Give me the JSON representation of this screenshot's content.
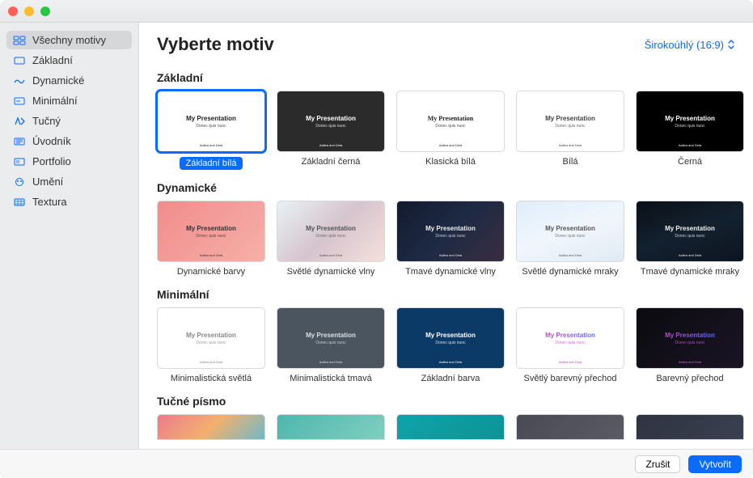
{
  "header": {
    "title": "Vyberte motiv",
    "aspect": "Širokoúhlý (16:9)"
  },
  "thumb_text": {
    "heading": "My Presentation",
    "sub": "Donec quis nunc",
    "foot": "Aaliea and Dela"
  },
  "sidebar": {
    "items": [
      {
        "label": "Všechny motivy",
        "icon": "grid-icon",
        "selected": true
      },
      {
        "label": "Základní",
        "icon": "basic-icon"
      },
      {
        "label": "Dynamické",
        "icon": "dynamic-icon"
      },
      {
        "label": "Minimální",
        "icon": "minimal-icon"
      },
      {
        "label": "Tučný",
        "icon": "bold-icon"
      },
      {
        "label": "Úvodník",
        "icon": "editorial-icon"
      },
      {
        "label": "Portfolio",
        "icon": "portfolio-icon"
      },
      {
        "label": "Umění",
        "icon": "art-icon"
      },
      {
        "label": "Textura",
        "icon": "texture-icon"
      }
    ]
  },
  "sections": [
    {
      "title": "Základní",
      "items": [
        {
          "label": "Základní bílá",
          "selected": true,
          "bg": "#ffffff",
          "fg": "#222"
        },
        {
          "label": "Základní černá",
          "bg": "#2b2b2b",
          "fg": "#fff"
        },
        {
          "label": "Klasická bílá",
          "bg": "#ffffff",
          "fg": "#222",
          "serif": true
        },
        {
          "label": "Bílá",
          "bg": "#ffffff",
          "fg": "#444"
        },
        {
          "label": "Černá",
          "bg": "#000000",
          "fg": "#fff"
        }
      ]
    },
    {
      "title": "Dynamické",
      "items": [
        {
          "label": "Dynamické barvy",
          "bg": "linear-gradient(135deg,#f08c8c,#f6b0a8)",
          "fg": "#333"
        },
        {
          "label": "Světlé dynamické vlny",
          "bg": "linear-gradient(135deg,#e8f2f4,#d6c4ce,#f4e1db)",
          "fg": "#555"
        },
        {
          "label": "Tmavé dynamické vlny",
          "bg": "linear-gradient(135deg,#121a2e,#1e2a44,#3a2d3f)",
          "fg": "#eee"
        },
        {
          "label": "Světlé dynamické mraky",
          "bg": "linear-gradient(160deg,#dfeefb,#f0f6fc,#e1eaf4)",
          "fg": "#555"
        },
        {
          "label": "Tmavé dynamické mraky",
          "bg": "linear-gradient(160deg,#0a1018,#13212e,#0d1420)",
          "fg": "#eee"
        },
        {
          "edge": true,
          "bg": "linear-gradient(180deg,#f6cfd7,#c8ecd2,#c8defa)"
        }
      ]
    },
    {
      "title": "Minimální",
      "items": [
        {
          "label": "Minimalistická světlá",
          "bg": "#ffffff",
          "fg": "#888"
        },
        {
          "label": "Minimalistická tmavá",
          "bg": "#4a5560",
          "fg": "#dcdfe3"
        },
        {
          "label": "Základní barva",
          "bg": "#0c3a66",
          "fg": "#fff"
        },
        {
          "label": "Světlý barevný přechod",
          "bg": "#ffffff",
          "fg": "#c048c6",
          "gradientText": true
        },
        {
          "label": "Barevný přechod",
          "bg": "linear-gradient(135deg,#0b0b0f,#1a1425)",
          "fg": "#d05fd6",
          "gradientText": true
        },
        {
          "edge": true,
          "bg": "#f5f0e8"
        }
      ]
    },
    {
      "title": "Tučné písmo",
      "bold": true,
      "items": [
        {
          "bg": "linear-gradient(135deg,#ec7a8d,#f3b06e,#6fbac8)"
        },
        {
          "bg": "linear-gradient(135deg,#4fb7ae,#7fcebf)"
        },
        {
          "bg": "linear-gradient(135deg,#0ea3a8,#0d9398)"
        },
        {
          "bg": "linear-gradient(135deg,#4a4a54,#5a5a64)"
        },
        {
          "bg": "linear-gradient(135deg,#2e3340,#3a4050)"
        }
      ]
    }
  ],
  "footer": {
    "cancel": "Zrušit",
    "create": "Vytvořit"
  }
}
